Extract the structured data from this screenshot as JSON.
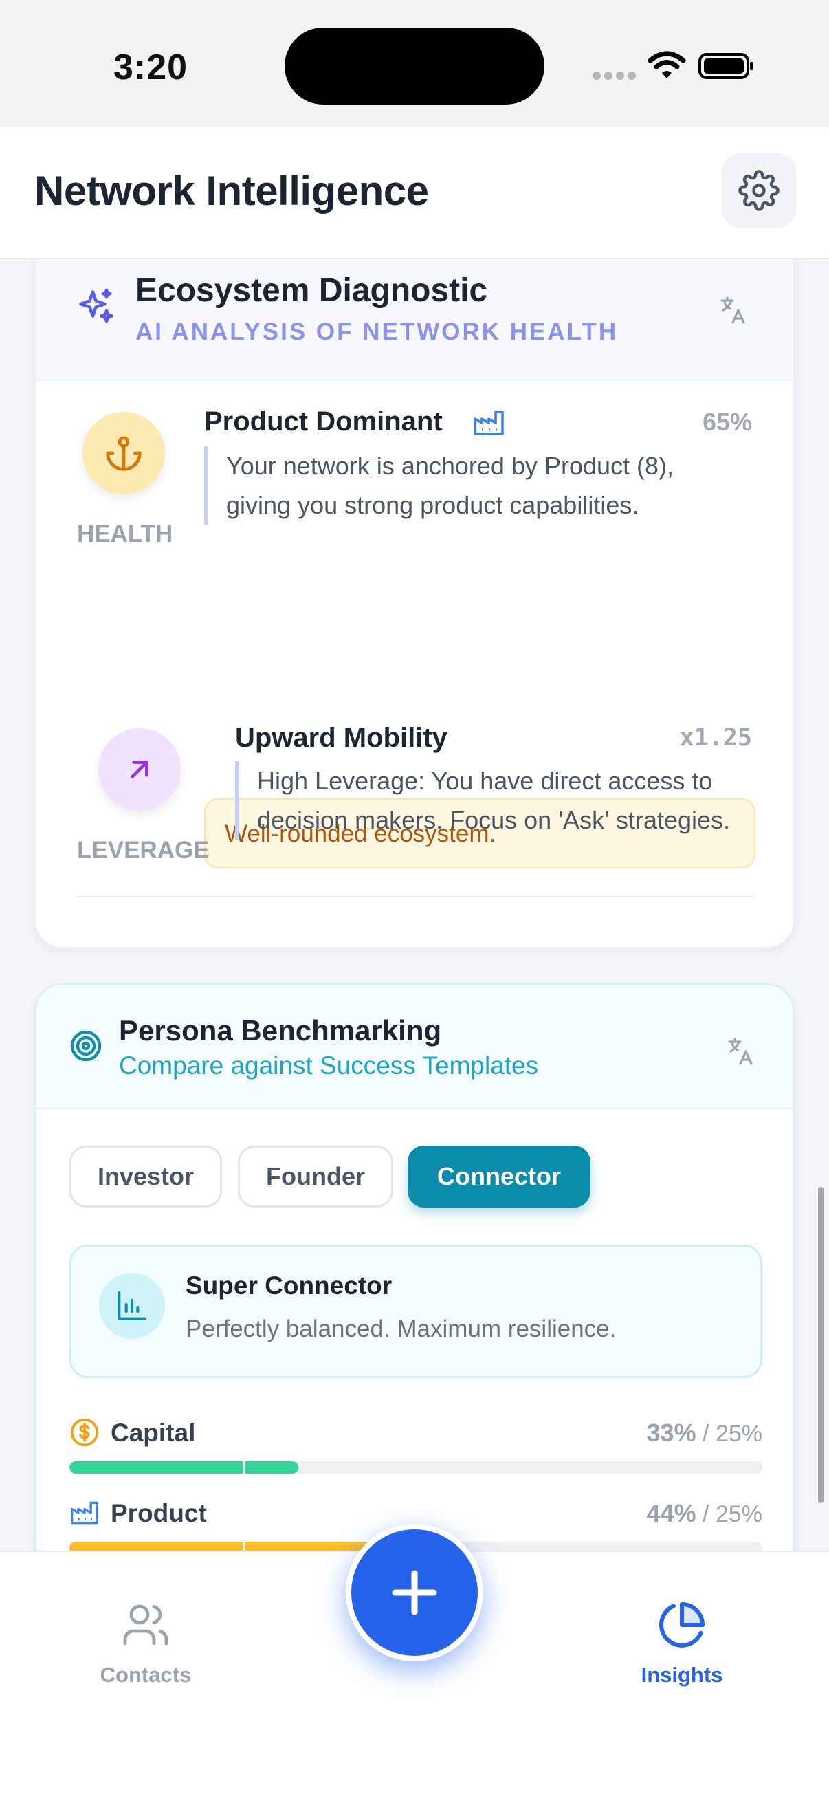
{
  "status_bar": {
    "time": "3:20"
  },
  "header": {
    "title": "Network Intelligence",
    "settings_icon": "gear-icon"
  },
  "ecosystem": {
    "title": "Ecosystem Diagnostic",
    "subtitle": "AI ANALYSIS OF NETWORK HEALTH",
    "metrics": [
      {
        "label": "HEALTH",
        "title": "Product Dominant",
        "value": "65%",
        "description": "Your network is anchored by Product (8), giving you strong product capabilities.",
        "note": "Well-rounded ecosystem.",
        "icon": "anchor-icon",
        "color": "#d97706"
      },
      {
        "label": "LEVERAGE",
        "title": "Upward Mobility",
        "value": "x1.25",
        "description": "High Leverage: You have direct access to decision makers. Focus on 'Ask' strategies.",
        "icon": "arrow-up-right-icon",
        "color": "#9333ea"
      }
    ]
  },
  "persona": {
    "title": "Persona Benchmarking",
    "subtitle": "Compare against Success Templates",
    "tabs": [
      "Investor",
      "Founder",
      "Connector"
    ],
    "active_tab": "Connector",
    "template": {
      "title": "Super Connector",
      "description": "Perfectly balanced. Maximum resilience."
    },
    "bars": [
      {
        "label": "Capital",
        "value": "33%",
        "target": "/ 25%",
        "fill": 0.33,
        "target_fill": 0.25,
        "color": "#34d399",
        "icon": "dollar-icon"
      },
      {
        "label": "Product",
        "value": "44%",
        "target": "/ 25%",
        "fill": 0.44,
        "target_fill": 0.25,
        "color": "#fbbf24",
        "icon": "factory-icon"
      }
    ]
  },
  "nav": {
    "items": [
      {
        "label": "Contacts",
        "icon": "users-icon",
        "active": false
      },
      {
        "label": "Insights",
        "icon": "pie-chart-icon",
        "active": true
      }
    ],
    "fab_icon": "plus-icon"
  },
  "colors": {
    "accent": "#2563eb",
    "teal": "#0c8cab",
    "indigo": "#6366f1"
  }
}
